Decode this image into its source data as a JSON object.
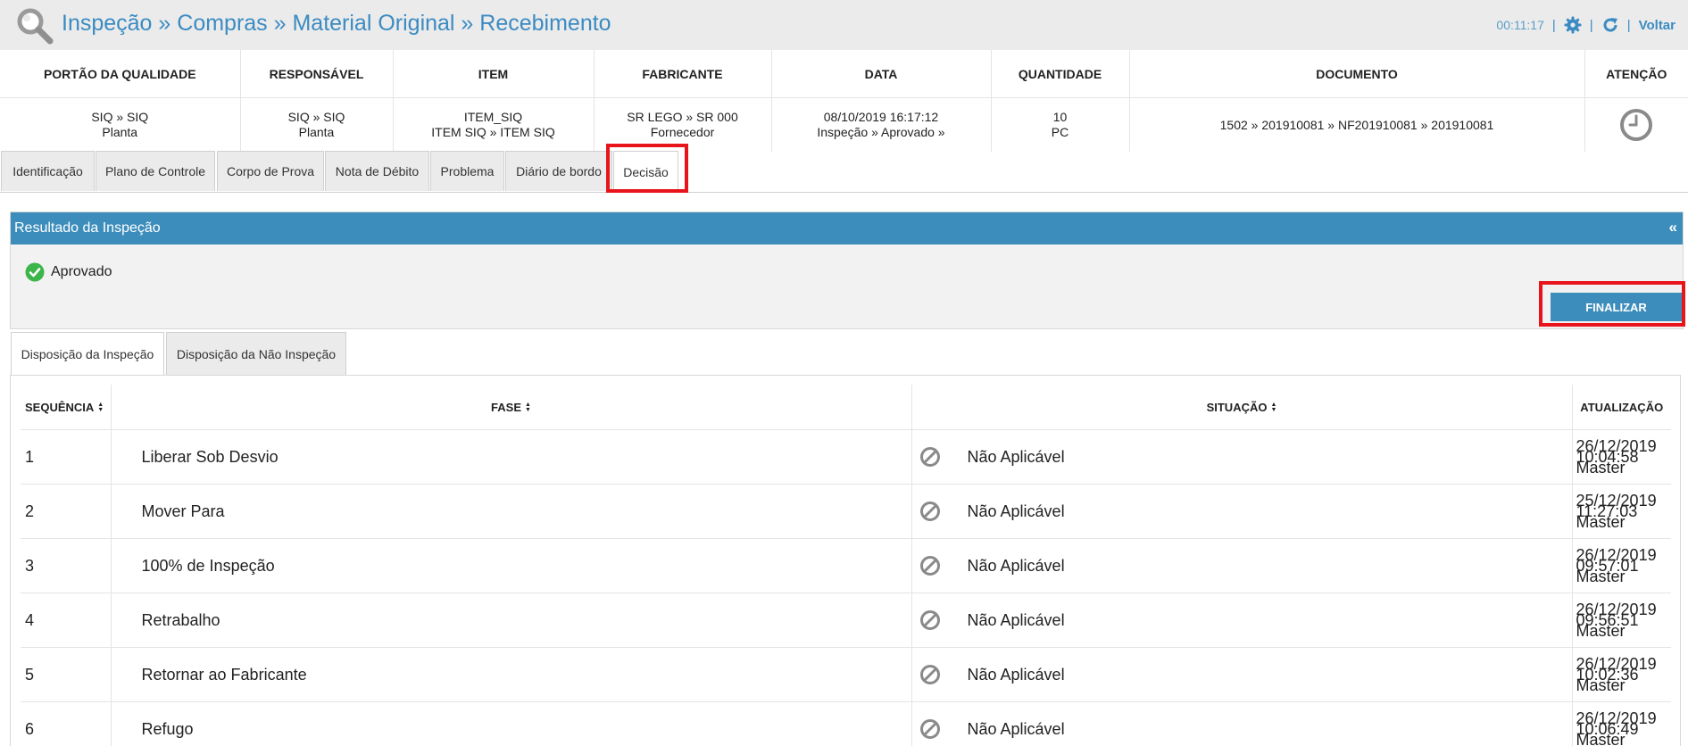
{
  "header": {
    "breadcrumb": "Inspeção » Compras » Material Original » Recebimento",
    "timer": "00:11:17",
    "back_label": "Voltar"
  },
  "info": {
    "headers": [
      "PORTÃO DA QUALIDADE",
      "RESPONSÁVEL",
      "ITEM",
      "FABRICANTE",
      "DATA",
      "QUANTIDADE",
      "DOCUMENTO",
      "ATENÇÃO"
    ],
    "quality_gate": [
      "SIQ » SIQ",
      "Planta"
    ],
    "responsible": [
      "SIQ » SIQ",
      "Planta"
    ],
    "item": [
      "ITEM_SIQ",
      "ITEM SIQ » ITEM SIQ"
    ],
    "manufacturer": [
      "SR LEGO » SR 000",
      "Fornecedor"
    ],
    "date": [
      "08/10/2019 16:17:12",
      "Inspeção » Aprovado »"
    ],
    "quantity": [
      "10",
      "PC"
    ],
    "document": "1502 » 201910081 » NF201910081 » 201910081"
  },
  "tabs": [
    "Identificação",
    "Plano de Controle",
    "Corpo de Prova",
    "Nota de Débito",
    "Problema",
    "Diário de bordo",
    "Decisão"
  ],
  "panel": {
    "title": "Resultado da Inspeção",
    "collapse": "«",
    "status": "Aprovado",
    "finalize_label": "FINALIZAR"
  },
  "subtabs": [
    "Disposição da Inspeção",
    "Disposição da Não Inspeção"
  ],
  "table": {
    "headers": [
      "SEQUÊNCIA",
      "FASE",
      "SITUAÇÃO",
      "ATUALIZAÇÃO"
    ],
    "rows": [
      {
        "seq": "1",
        "fase": "Liberar Sob Desvio",
        "situacao": "Não Aplicável",
        "date": "26/12/2019",
        "time": "10:04:58",
        "user": "Master"
      },
      {
        "seq": "2",
        "fase": "Mover Para",
        "situacao": "Não Aplicável",
        "date": "25/12/2019",
        "time": "11:27:03",
        "user": "Master"
      },
      {
        "seq": "3",
        "fase": "100% de Inspeção",
        "situacao": "Não Aplicável",
        "date": "26/12/2019",
        "time": "09:57:01",
        "user": "Master"
      },
      {
        "seq": "4",
        "fase": "Retrabalho",
        "situacao": "Não Aplicável",
        "date": "26/12/2019",
        "time": "09:56:51",
        "user": "Master"
      },
      {
        "seq": "5",
        "fase": "Retornar ao Fabricante",
        "situacao": "Não Aplicável",
        "date": "26/12/2019",
        "time": "10:02:36",
        "user": "Master"
      },
      {
        "seq": "6",
        "fase": "Refugo",
        "situacao": "Não Aplicável",
        "date": "26/12/2019",
        "time": "10:06:49",
        "user": "Master"
      }
    ]
  },
  "colors": {
    "accent": "#3c8dbc",
    "highlight": "#e8141b",
    "approved": "#3cb54a"
  }
}
